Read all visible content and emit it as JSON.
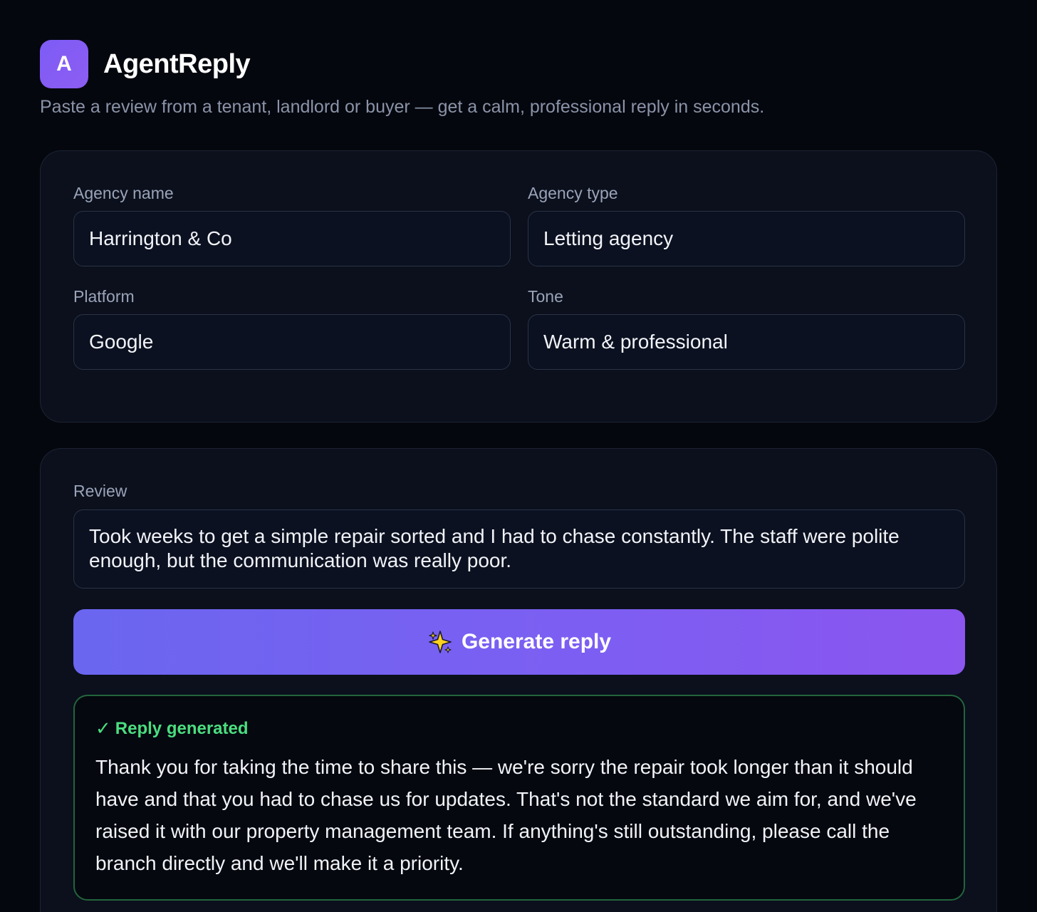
{
  "app": {
    "logo_letter": "A",
    "name": "AgentReply",
    "tagline": "Paste a review from a tenant, landlord or buyer — get a calm, professional reply in seconds."
  },
  "settings": {
    "agency_name": {
      "label": "Agency name",
      "value": "Harrington & Co"
    },
    "agency_type": {
      "label": "Agency type",
      "value": "Letting agency"
    },
    "platform": {
      "label": "Platform",
      "value": "Google"
    },
    "tone": {
      "label": "Tone",
      "value": "Warm & professional"
    }
  },
  "review": {
    "label": "Review",
    "text": "Took weeks to get a simple repair sorted and I had to chase constantly. The staff were polite enough, but the communication was really poor."
  },
  "generate_button": {
    "icon": "sparkles-icon",
    "label": "Generate reply"
  },
  "result": {
    "status_icon": "check-icon",
    "status": "Reply generated",
    "text": "Thank you for taking the time to share this — we're sorry the repair took longer than it should have and that you had to chase us for updates. That's not the standard we aim for, and we've raised it with our property management team. If anything's still outstanding, please call the branch directly and we'll make it a priority."
  },
  "colors": {
    "background": "#05070e",
    "card": "#0b101c",
    "accent_start": "#6a66f0",
    "accent_end": "#8b55f0",
    "success": "#4ade80"
  }
}
